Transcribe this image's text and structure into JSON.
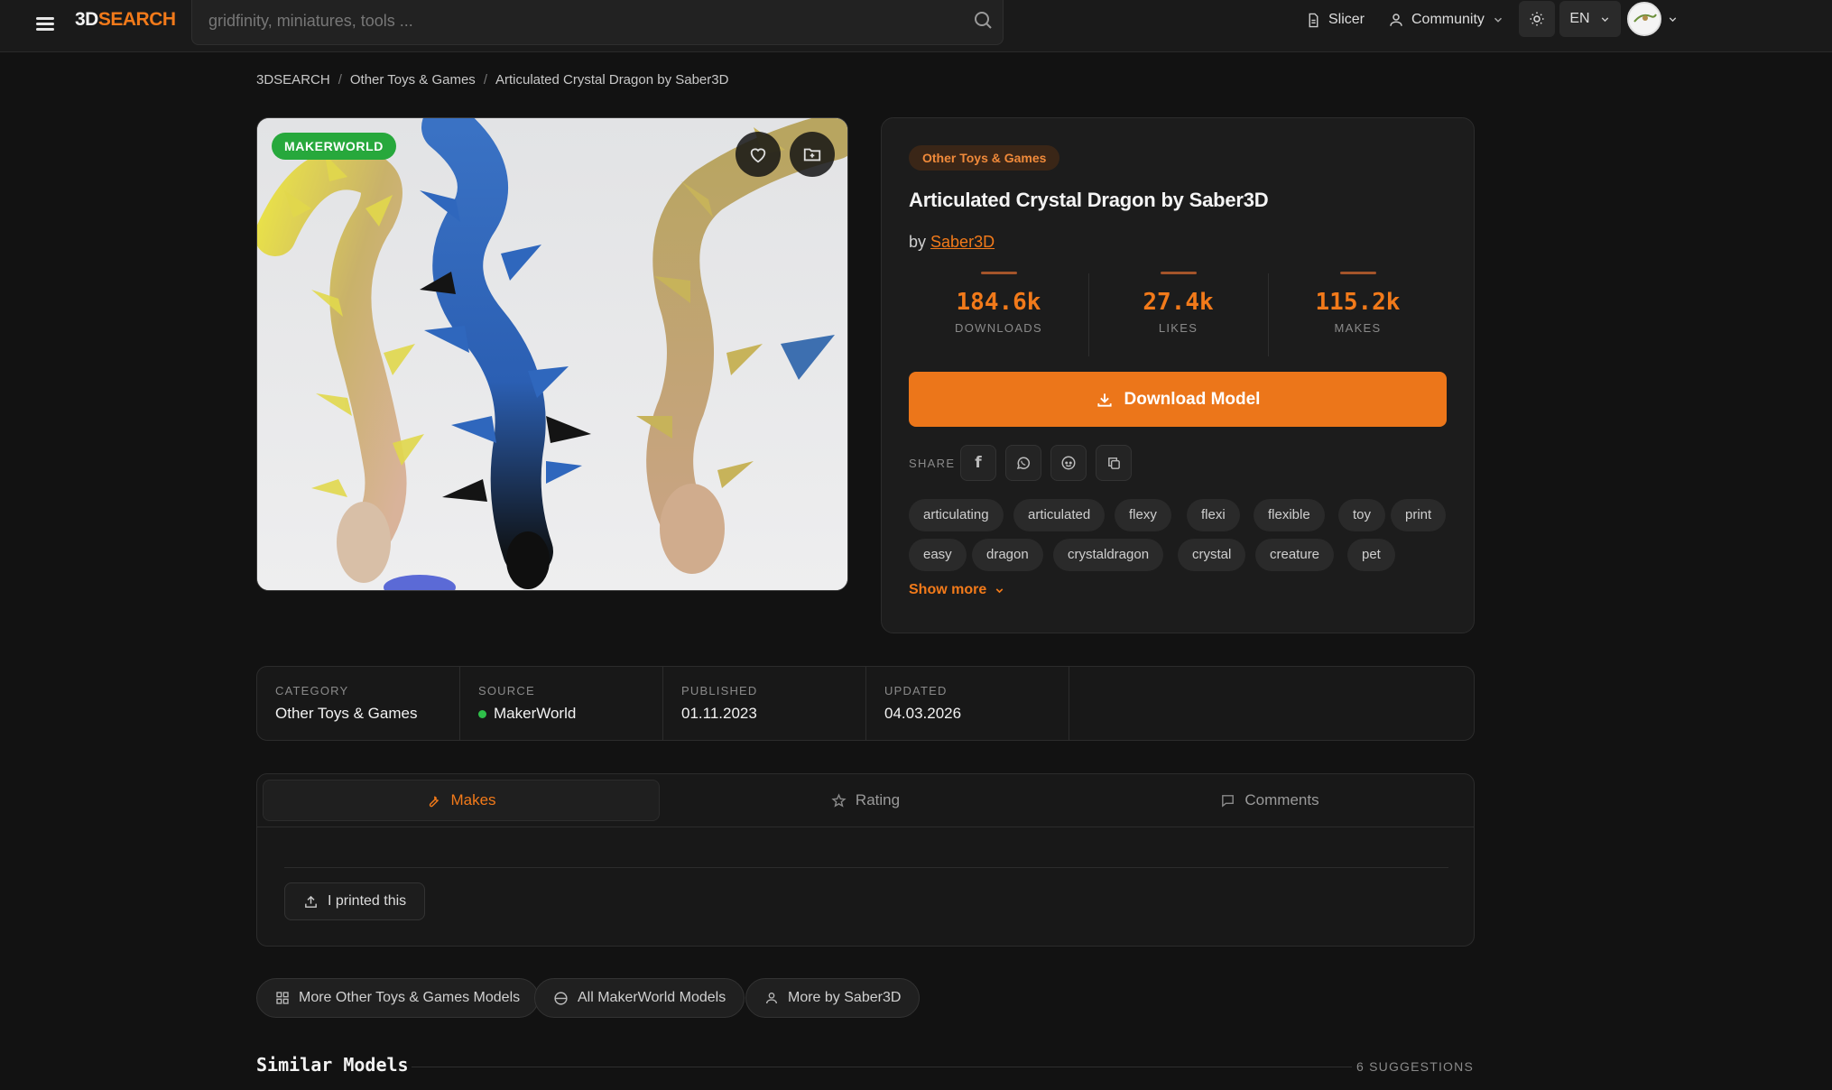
{
  "header": {
    "logo_prefix": "3D",
    "logo_suffix": "SEARCH",
    "search_placeholder": "gridfinity, miniatures, tools ...",
    "slicer_label": "Slicer",
    "community_label": "Community",
    "lang_label": "EN"
  },
  "breadcrumb": {
    "home": "3DSEARCH",
    "category": "Other Toys & Games",
    "current": "Articulated Crystal Dragon by Saber3D"
  },
  "gallery": {
    "source_badge": "MAKERWORLD"
  },
  "model": {
    "category": "Other Toys & Games",
    "title": "Articulated Crystal Dragon by Saber3D",
    "by_prefix": "by",
    "author": "Saber3D",
    "stats": [
      {
        "value": "184.6k",
        "label": "DOWNLOADS"
      },
      {
        "value": "27.4k",
        "label": "LIKES"
      },
      {
        "value": "115.2k",
        "label": "MAKES"
      }
    ],
    "download_label": "Download Model",
    "share_label": "SHARE",
    "tags": [
      "articulating",
      "articulated",
      "flexy",
      "flexi",
      "flexible",
      "toy",
      "print",
      "easy",
      "dragon",
      "crystaldragon",
      "crystal",
      "creature",
      "pet"
    ],
    "show_more_label": "Show more"
  },
  "meta": [
    {
      "key": "CATEGORY",
      "value": "Other Toys & Games"
    },
    {
      "key": "SOURCE",
      "value": "MakerWorld"
    },
    {
      "key": "PUBLISHED",
      "value": "01.11.2023"
    },
    {
      "key": "UPDATED",
      "value": "04.03.2026"
    }
  ],
  "tabs": {
    "items": [
      {
        "label": "Makes",
        "active": true
      },
      {
        "label": "Rating",
        "active": false
      },
      {
        "label": "Comments",
        "active": false
      }
    ],
    "printed_label": "I printed this"
  },
  "links": {
    "more_category": "More Other Toys & Games Models",
    "all_source": "All MakerWorld Models",
    "more_author": "More by Saber3D"
  },
  "similar": {
    "title": "Similar Models",
    "count": "6 SUGGESTIONS"
  },
  "colors": {
    "accent": "#f27a1a",
    "background": "#121212",
    "card": "#1c1c1c",
    "source_green": "#27a83c"
  }
}
